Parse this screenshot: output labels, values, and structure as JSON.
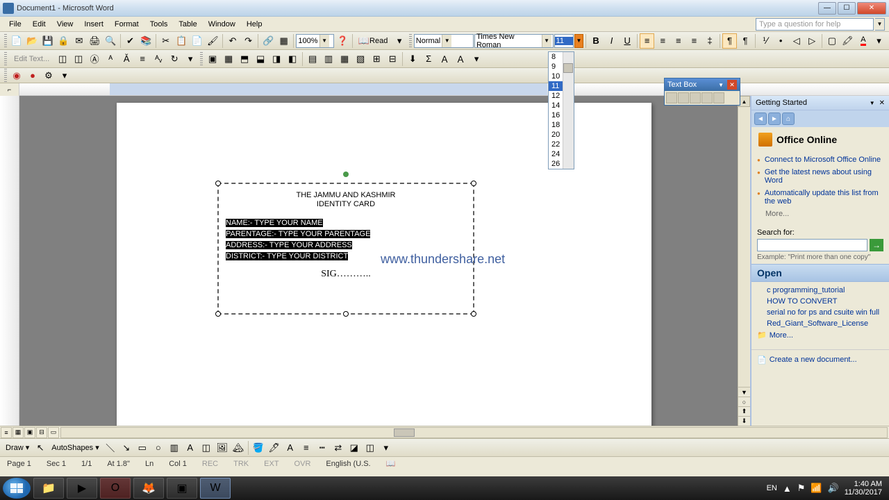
{
  "window": {
    "title": "Document1 - Microsoft Word"
  },
  "menu": {
    "items": [
      "File",
      "Edit",
      "View",
      "Insert",
      "Format",
      "Tools",
      "Table",
      "Window",
      "Help"
    ],
    "help_placeholder": "Type a question for help"
  },
  "toolbar1": {
    "zoom": "100%",
    "read": "Read"
  },
  "toolbar2": {
    "style": "Normal",
    "font": "Times New Roman",
    "font_size": "11",
    "bold": "B",
    "italic": "I",
    "underline": "U"
  },
  "toolbar3": {
    "edit_text": "Edit Text..."
  },
  "font_sizes": [
    "8",
    "9",
    "10",
    "11",
    "12",
    "14",
    "16",
    "18",
    "20",
    "22",
    "24",
    "26"
  ],
  "font_size_highlighted": "11",
  "document": {
    "title1": "THE JAMMU AND KASHMIR",
    "title2": "IDENTITY CARD",
    "line1": "NAME:- TYPE YOUR NAME",
    "line2": "PARENTAGE:- TYPE YOUR PARENTAGE",
    "line3": "ADDRESS:- TYPE YOUR ADDRESS",
    "line4": "DISTRICT:- TYPE YOUR DISTRICT",
    "signature": "SIG………..",
    "watermark": "www.thundershare.net"
  },
  "float_toolbar": {
    "title": "Text Box"
  },
  "taskpane": {
    "header": "Getting Started",
    "brand": "Office Online",
    "links": [
      "Connect to Microsoft Office Online",
      "Get the latest news about using Word",
      "Automatically update this list from the web"
    ],
    "more": "More...",
    "search_label": "Search for:",
    "search_example": "Example: \"Print more than one copy\"",
    "open_header": "Open",
    "open_items": [
      "c programming_tutorial",
      "HOW TO CONVERT",
      "serial no for ps and csuite win full",
      "Red_Giant_Software_License"
    ],
    "open_more": "More...",
    "create_new": "Create a new document..."
  },
  "drawbar": {
    "draw": "Draw",
    "autoshapes": "AutoShapes"
  },
  "status": {
    "page": "Page 1",
    "sec": "Sec 1",
    "pages": "1/1",
    "at": "At 1.8\"",
    "ln": "Ln",
    "col": "Col 1",
    "rec": "REC",
    "trk": "TRK",
    "ext": "EXT",
    "ovr": "OVR",
    "lang": "English (U.S."
  },
  "taskbar": {
    "lang": "EN",
    "time": "1:40 AM",
    "date": "11/30/2017"
  }
}
